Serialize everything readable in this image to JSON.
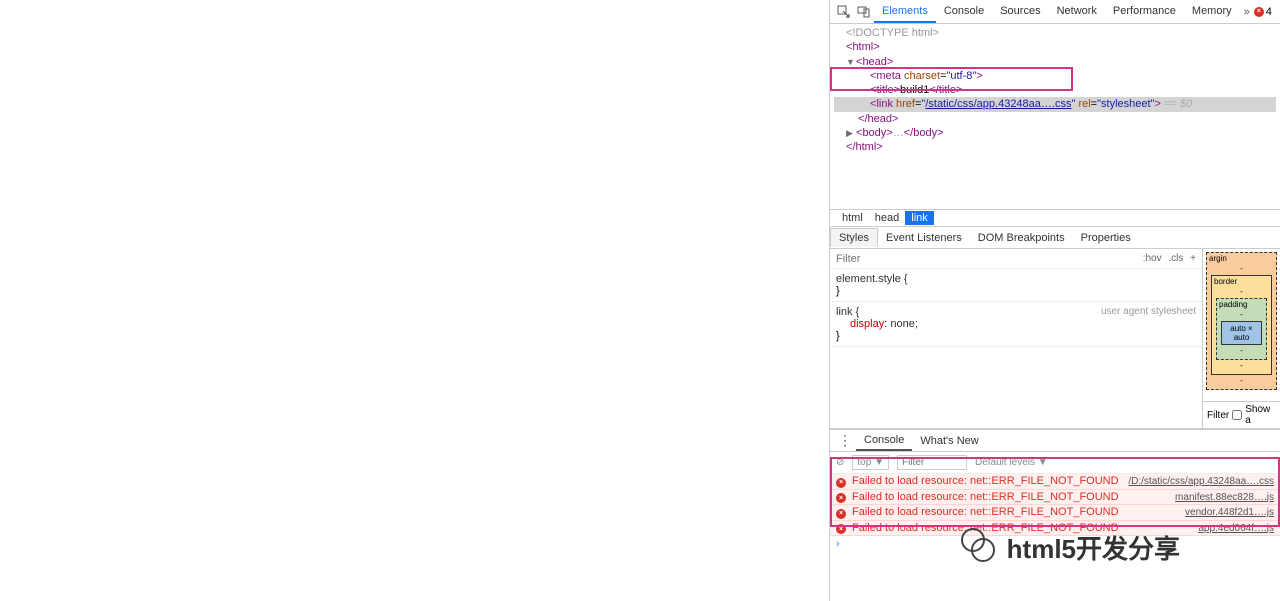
{
  "toolbar": {
    "tabs": [
      "Elements",
      "Console",
      "Sources",
      "Network",
      "Performance",
      "Memory"
    ],
    "active": "Elements",
    "error_count": "4"
  },
  "dom": {
    "doctype": "<!DOCTYPE html>",
    "html_open": "html",
    "head_open": "head",
    "meta_attr_name": "charset",
    "meta_attr_val": "utf-8",
    "title_tag": "title",
    "title_text": "build1",
    "link_tag": "link",
    "link_href_attr": "href",
    "link_href_val": "/static/css/app.43248aa….css",
    "link_rel_attr": "rel",
    "link_rel_val": "stylesheet",
    "selected_marker": " == $0",
    "head_close": "/head",
    "body_tag": "body",
    "body_dots": "…",
    "html_close": "/html"
  },
  "breadcrumb": {
    "items": [
      "html",
      "head",
      "link"
    ],
    "active": "link"
  },
  "subtabs": {
    "items": [
      "Styles",
      "Event Listeners",
      "DOM Breakpoints",
      "Properties"
    ],
    "active": "Styles"
  },
  "styles": {
    "filter_placeholder": "Filter",
    "hov": ":hov",
    "cls": ".cls",
    "element_style": "element.style {",
    "close_brace": "}",
    "link_selector": "link {",
    "ua_label": "user agent stylesheet",
    "display_prop": "display",
    "display_val": "none;"
  },
  "box_model": {
    "margin": "argin",
    "border": "border",
    "padding": "padding",
    "content": "auto × auto",
    "dash": "-",
    "filter_label": "Filter",
    "show_label": "Show a"
  },
  "drawer": {
    "tabs": [
      "Console",
      "What's New"
    ],
    "active": "Console",
    "ctx": "top",
    "filter_placeholder": "Filter",
    "levels": "Default levels ▼"
  },
  "console": {
    "msgs": [
      {
        "text": "Failed to load resource: net::ERR_FILE_NOT_FOUND",
        "src": "/D:/static/css/app.43248aa….css"
      },
      {
        "text": "Failed to load resource: net::ERR_FILE_NOT_FOUND",
        "src": "manifest.88ec828….js"
      },
      {
        "text": "Failed to load resource: net::ERR_FILE_NOT_FOUND",
        "src": "vendor.448f2d1….js"
      },
      {
        "text": "Failed to load resource: net::ERR_FILE_NOT_FOUND",
        "src": "app.4ed064f….js"
      }
    ]
  },
  "watermark": "html5开发分享"
}
